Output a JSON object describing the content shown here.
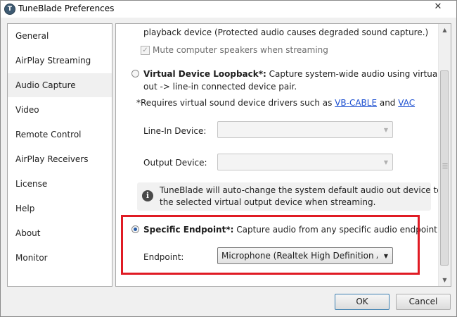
{
  "window": {
    "title": "TuneBlade Preferences",
    "app_icon_glyph": "T",
    "close_glyph": "✕"
  },
  "sidebar": {
    "items": [
      {
        "label": "General"
      },
      {
        "label": "AirPlay Streaming"
      },
      {
        "label": "Audio Capture",
        "selected": true
      },
      {
        "label": "Video"
      },
      {
        "label": "Remote Control"
      },
      {
        "label": "AirPlay Receivers"
      },
      {
        "label": "License"
      },
      {
        "label": "Help"
      },
      {
        "label": "About"
      },
      {
        "label": "Monitor"
      }
    ]
  },
  "content": {
    "playback_line": "playback device (Protected audio causes degraded sound capture.)",
    "mute_checkbox": {
      "label": "Mute computer speakers when streaming",
      "checked": true,
      "disabled": true
    },
    "virtual_loopback": {
      "title": "Virtual Device Loopback*:",
      "desc_line1": " Capture system-wide audio using virtual line-",
      "desc_line2": "out -> line-in connected device pair.",
      "selected": false
    },
    "requires": {
      "prefix": "*Requires virtual sound device drivers such as ",
      "link1": "VB-CABLE",
      "and": " and ",
      "link2": "VAC"
    },
    "line_in_device": {
      "label": "Line-In Device:",
      "value": ""
    },
    "output_device": {
      "label": "Output Device:",
      "value": ""
    },
    "info": {
      "line1": "TuneBlade will auto-change the system default audio out device to",
      "line2": "the selected virtual output device when streaming."
    },
    "specific_endpoint": {
      "title": "Specific Endpoint*:",
      "desc": " Capture audio from any specific audio endpoint.",
      "selected": true
    },
    "endpoint": {
      "label": "Endpoint:",
      "value": "Microphone (Realtek High Definition Audio)"
    }
  },
  "scrollbar": {
    "up_glyph": "▲",
    "down_glyph": "▼"
  },
  "buttons": {
    "ok": "OK",
    "cancel": "Cancel"
  },
  "colors": {
    "highlight": "#e01b24",
    "link": "#1c4fd0",
    "radio_selected": "#2a5ea8"
  }
}
